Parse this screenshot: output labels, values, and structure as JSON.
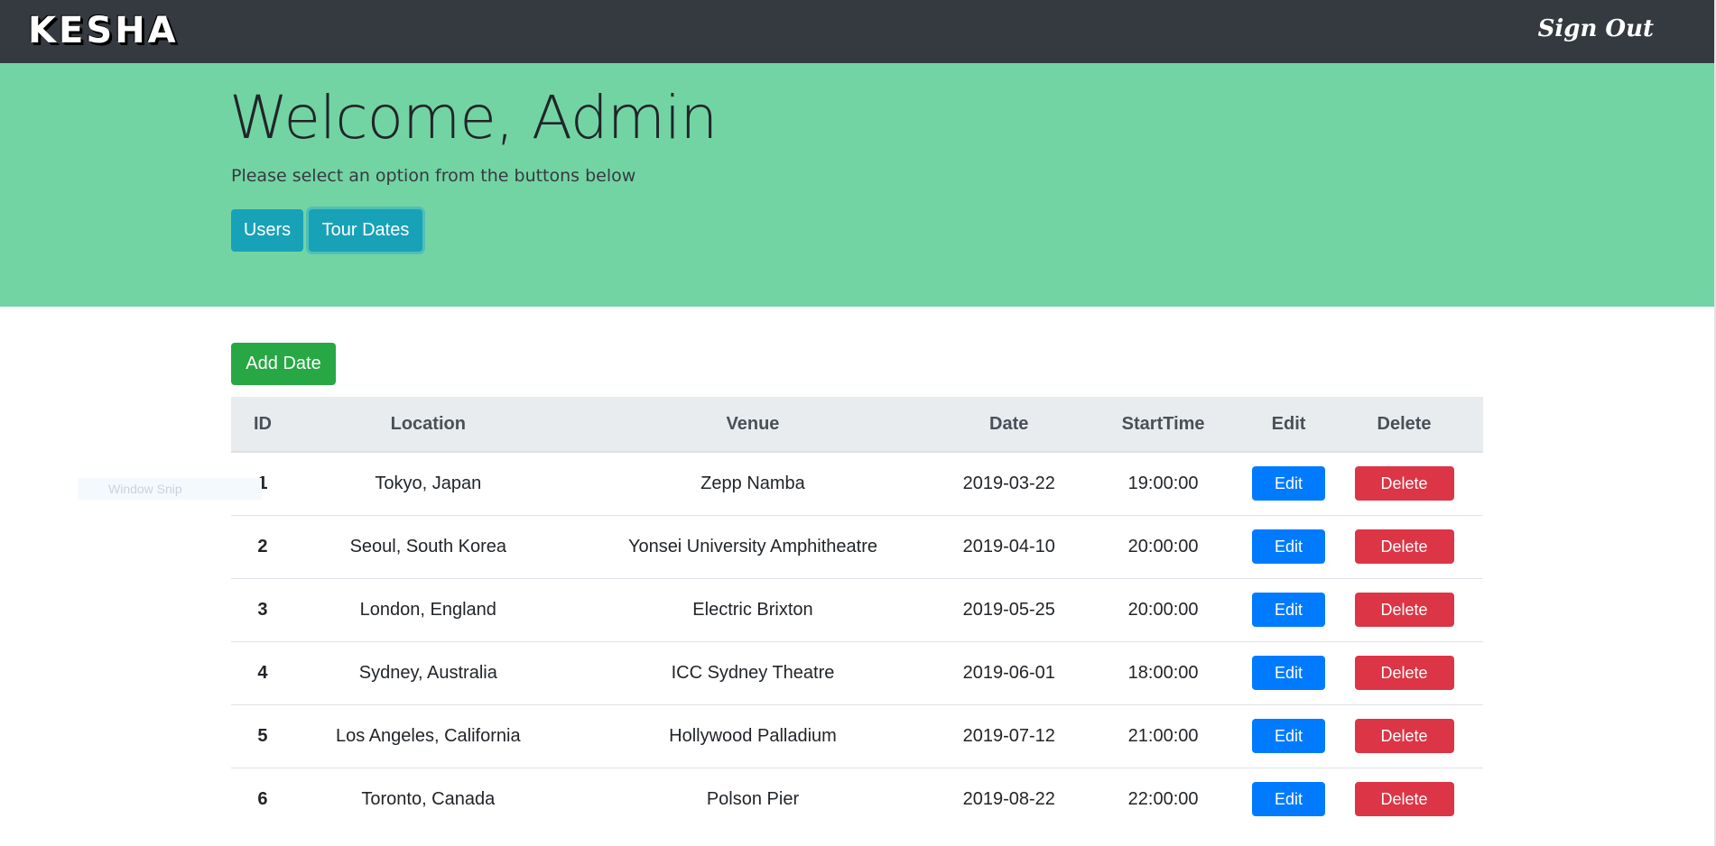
{
  "navbar": {
    "brand": "KESHA",
    "sign_out": "Sign Out"
  },
  "hero": {
    "title": "Welcome, Admin",
    "subtitle": "Please select an option from the buttons below",
    "buttons": {
      "users": "Users",
      "tour_dates": "Tour Dates"
    }
  },
  "actions": {
    "add_date": "Add Date"
  },
  "overlay_text": "Window Snip",
  "table": {
    "headers": [
      "ID",
      "Location",
      "Venue",
      "Date",
      "StartTime",
      "Edit",
      "Delete"
    ],
    "edit_label": "Edit",
    "delete_label": "Delete",
    "rows": [
      {
        "id": "1",
        "location": "Tokyo, Japan",
        "venue": "Zepp Namba",
        "date": "2019-03-22",
        "start_time": "19:00:00"
      },
      {
        "id": "2",
        "location": "Seoul, South Korea",
        "venue": "Yonsei University Amphitheatre",
        "date": "2019-04-10",
        "start_time": "20:00:00"
      },
      {
        "id": "3",
        "location": "London, England",
        "venue": "Electric Brixton",
        "date": "2019-05-25",
        "start_time": "20:00:00"
      },
      {
        "id": "4",
        "location": "Sydney, Australia",
        "venue": "ICC Sydney Theatre",
        "date": "2019-06-01",
        "start_time": "18:00:00"
      },
      {
        "id": "5",
        "location": "Los Angeles, California",
        "venue": "Hollywood Palladium",
        "date": "2019-07-12",
        "start_time": "21:00:00"
      },
      {
        "id": "6",
        "location": "Toronto, Canada",
        "venue": "Polson Pier",
        "date": "2019-08-22",
        "start_time": "22:00:00"
      }
    ]
  },
  "colors": {
    "navbar": "#343a40",
    "hero": "#73d4a3",
    "info": "#17a2b8",
    "success": "#28a745",
    "primary": "#007bff",
    "danger": "#dc3545"
  }
}
